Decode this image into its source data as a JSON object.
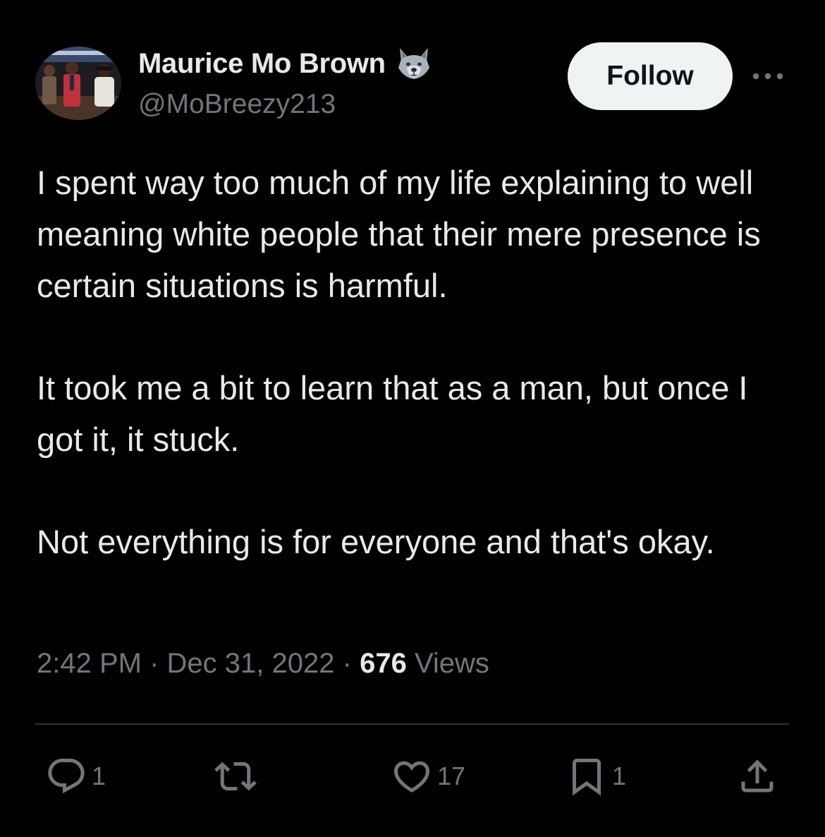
{
  "author": {
    "display_name": "Maurice Mo Brown",
    "handle": "@MoBreezy213",
    "badge_icon": "wolf-emoji-icon",
    "avatar_icon": "profile-photo-avatar"
  },
  "header": {
    "follow_label": "Follow",
    "more_icon": "more-horizontal-icon"
  },
  "tweet": {
    "paragraphs": [
      "I spent way too much of my life explaining to well meaning white people that their mere presence is certain situations is harmful.",
      "It took me a bit to learn that as a man, but once I got it, it stuck.",
      "Not everything is for everyone and that's okay."
    ]
  },
  "meta": {
    "time": "2:42 PM",
    "separator": "·",
    "date": "Dec 31, 2022",
    "views_count": "676",
    "views_label": "Views"
  },
  "actions": {
    "reply": {
      "icon": "reply-icon",
      "count": "1"
    },
    "retweet": {
      "icon": "retweet-icon",
      "count": ""
    },
    "like": {
      "icon": "heart-icon",
      "count": "17"
    },
    "bookmark": {
      "icon": "bookmark-icon",
      "count": "1"
    },
    "share": {
      "icon": "share-icon",
      "count": ""
    }
  },
  "colors": {
    "background": "#000000",
    "primary_text": "#e7e9ea",
    "secondary_text": "#71767b",
    "divider": "#2f3336",
    "follow_button_bg": "#eff3f4",
    "follow_button_text": "#0f1419"
  }
}
